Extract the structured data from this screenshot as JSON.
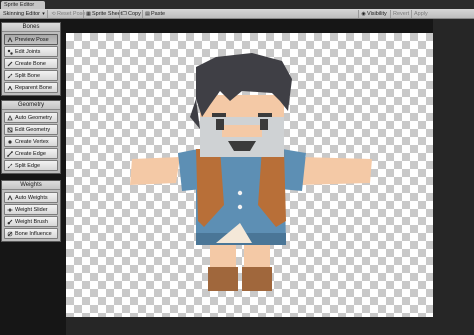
{
  "window": {
    "title": "Sprite Editor"
  },
  "toolbar": {
    "mode": "Skinning Editor",
    "reset_pose": "Reset Pose",
    "sprite_sheet": "Sprite Sheet",
    "copy": "Copy",
    "paste": "Paste",
    "visibility": "Visibility",
    "revert": "Revert",
    "apply": "Apply"
  },
  "panels": {
    "bones": {
      "title": "Bones",
      "items": [
        "Preview Pose",
        "Edit Joints",
        "Create Bone",
        "Split Bone",
        "Reparent Bone"
      ]
    },
    "geometry": {
      "title": "Geometry",
      "items": [
        "Auto Geometry",
        "Edit Geometry",
        "Create Vertex",
        "Create Edge",
        "Split Edge"
      ]
    },
    "weights": {
      "title": "Weights",
      "items": [
        "Auto Weights",
        "Weight Slider",
        "Weight Brush",
        "Bone Influence"
      ]
    }
  },
  "icons": {
    "preview_pose": "pose-icon",
    "edit_joints": "joints-icon",
    "create_bone": "bone-icon",
    "split_bone": "split-icon",
    "reparent_bone": "reparent-icon"
  },
  "colors": {
    "canvas_checker": "#c9c9c9",
    "panel_bg": "#bdbdbd",
    "workarea_bg": "#161616"
  }
}
